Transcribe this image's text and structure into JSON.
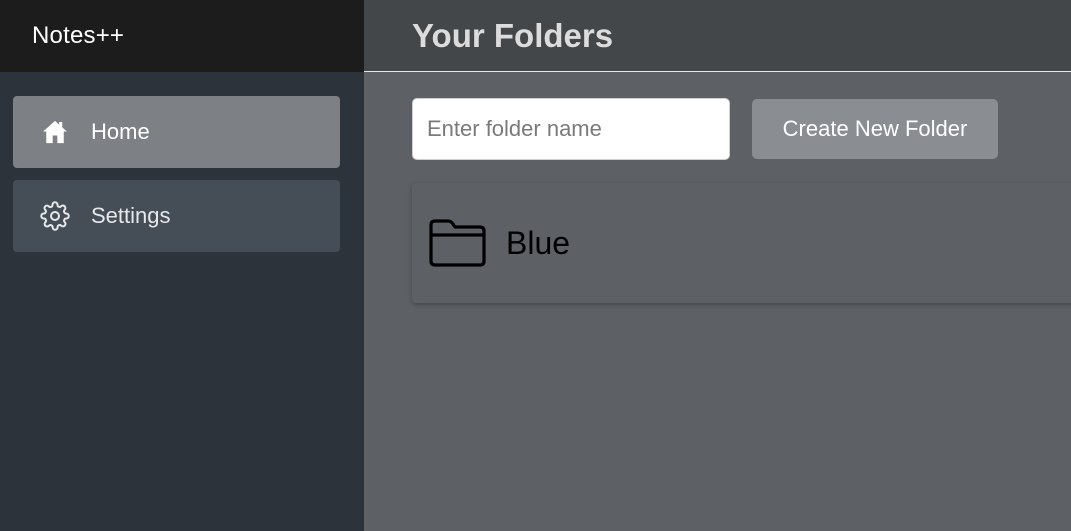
{
  "app": {
    "title": "Notes++"
  },
  "sidebar": {
    "items": [
      {
        "label": "Home",
        "icon": "home-icon",
        "active": true
      },
      {
        "label": "Settings",
        "icon": "gear-icon",
        "active": false
      }
    ]
  },
  "header": {
    "title": "Your Folders"
  },
  "toolbar": {
    "input_placeholder": "Enter folder name",
    "input_value": "",
    "create_label": "Create New Folder"
  },
  "folders": [
    {
      "name": "Blue",
      "icon": "folder-icon"
    }
  ],
  "colors": {
    "brand_bg": "#1c1c1c",
    "sidebar_bg": "#2d333a",
    "nav_active_bg": "#7d8185",
    "nav_inactive_bg": "#454d56",
    "header_bg": "#444749",
    "main_bg": "#5d6065",
    "button_bg": "#8a8e93"
  }
}
